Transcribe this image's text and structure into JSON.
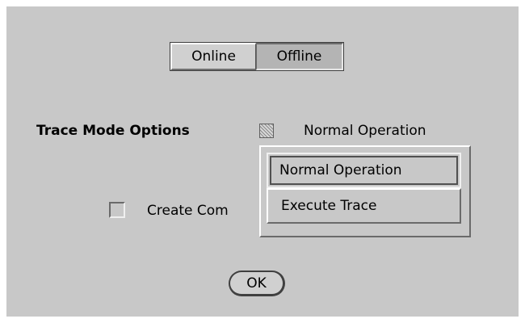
{
  "mode_toggle": {
    "online_label": "Online",
    "offline_label": "Offline",
    "selected": "Offline"
  },
  "trace_mode": {
    "label": "Trace Mode Options",
    "icon": "menu-glyph-icon",
    "current_value": "Normal Operation"
  },
  "trace_menu": {
    "items": [
      {
        "label": "Normal Operation",
        "highlighted": true
      },
      {
        "label": "Execute Trace",
        "highlighted": false
      }
    ]
  },
  "create_checkbox": {
    "label": "Create Com",
    "checked": false
  },
  "ok_button": {
    "label": "OK"
  }
}
